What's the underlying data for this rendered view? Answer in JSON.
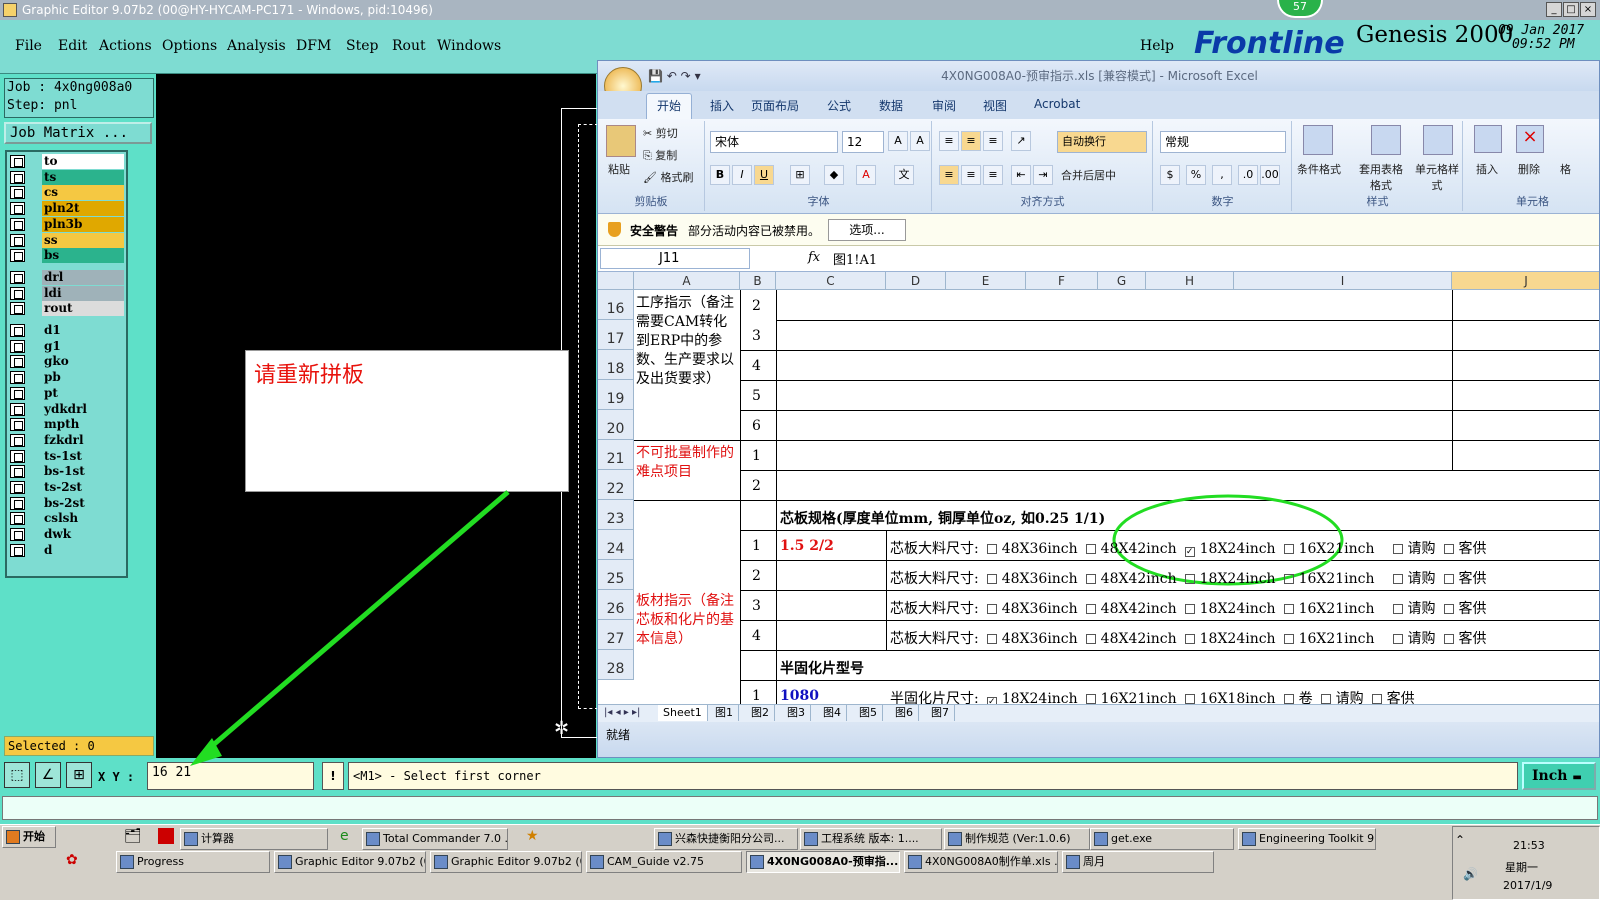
{
  "genesis": {
    "window_title": "Graphic Editor 9.07b2 (00@HY-HYCAM-PC171 - Windows, pid:10496)",
    "menu": [
      "File",
      "Edit",
      "Actions",
      "Options",
      "Analysis",
      "DFM",
      "Step",
      "Rout",
      "Windows"
    ],
    "help": "Help",
    "badge": "57",
    "brand": {
      "logo": "Frontline",
      "product": "Genesis 2000",
      "date": "09 Jan 2017",
      "time": "09:52 PM"
    },
    "job": "Job : 4x0ng008a0",
    "step": "Step: pnl",
    "job_matrix": "Job Matrix ...",
    "layers": [
      {
        "name": "to",
        "color": "#ffffff"
      },
      {
        "name": "ts",
        "color": "#2bb38d"
      },
      {
        "name": "cs",
        "color": "#f5c842"
      },
      {
        "name": "pln2t",
        "color": "#e0a800"
      },
      {
        "name": "pln3b",
        "color": "#e0a800"
      },
      {
        "name": "ss",
        "color": "#f5c842"
      },
      {
        "name": "bs",
        "color": "#2bb38d"
      },
      {
        "name": "drl",
        "color": "#9fb2b9"
      },
      {
        "name": "ldi",
        "color": "#9fb2b9"
      },
      {
        "name": "rout",
        "color": "#dcdcdc"
      },
      {
        "name": "d1",
        "color": "#7edcd2"
      },
      {
        "name": "g1",
        "color": "#7edcd2"
      },
      {
        "name": "gko",
        "color": "#7edcd2"
      },
      {
        "name": "pb",
        "color": "#7edcd2"
      },
      {
        "name": "pt",
        "color": "#7edcd2"
      },
      {
        "name": "ydkdrl",
        "color": "#7edcd2"
      },
      {
        "name": "mpth",
        "color": "#7edcd2"
      },
      {
        "name": "fzkdrl",
        "color": "#7edcd2"
      },
      {
        "name": "ts-1st",
        "color": "#7edcd2"
      },
      {
        "name": "bs-1st",
        "color": "#7edcd2"
      },
      {
        "name": "ts-2st",
        "color": "#7edcd2"
      },
      {
        "name": "bs-2st",
        "color": "#7edcd2"
      },
      {
        "name": "cslsh",
        "color": "#7edcd2"
      },
      {
        "name": "dwk",
        "color": "#7edcd2"
      },
      {
        "name": "d",
        "color": "#7edcd2"
      }
    ],
    "selected": "Selected : 0",
    "note_text": "请重新拼板",
    "xy_label": "X Y :",
    "xy_value": "16 21",
    "prompt": "<M1> - Select first corner",
    "unit": "Inch"
  },
  "excel": {
    "title": "4X0NG008A0-预审指示.xls  [兼容模式] - Microsoft Excel",
    "tabs": [
      "开始",
      "插入",
      "页面布局",
      "公式",
      "数据",
      "审阅",
      "视图",
      "Acrobat"
    ],
    "clipboard": {
      "paste": "粘贴",
      "cut": "剪切",
      "copy": "复制",
      "format_painter": "格式刷",
      "label": "剪贴板"
    },
    "font": {
      "name": "宋体",
      "size": "12",
      "label": "字体"
    },
    "alignment": {
      "wrap": "自动换行",
      "merge": "合并后居中",
      "label": "对齐方式"
    },
    "number": {
      "format": "常规",
      "label": "数字"
    },
    "styles": {
      "cond": "条件格式",
      "table": "套用表格格式",
      "cell": "单元格样式",
      "label": "样式"
    },
    "cells": {
      "insert": "插入",
      "delete": "删除",
      "format": "格",
      "label": "单元格"
    },
    "security": {
      "title": "安全警告",
      "message": "部分活动内容已被禁用。",
      "options": "选项..."
    },
    "name_box": "J11",
    "formula": "图1!A1",
    "columns": [
      "A",
      "B",
      "C",
      "D",
      "E",
      "F",
      "G",
      "H",
      "I",
      "J"
    ],
    "rows": [
      "16",
      "17",
      "18",
      "19",
      "20",
      "21",
      "22",
      "23",
      "24",
      "25",
      "26",
      "27",
      "28"
    ],
    "section1": "工序指示（备注需要CAM转化到ERP中的参数、生产要求以及出货要求）",
    "section1_nums": [
      "2",
      "3",
      "4",
      "5",
      "6"
    ],
    "section2": "不可批量制作的难点项目",
    "section2_nums": [
      "1",
      "2"
    ],
    "section3": "板材指示（备注芯板和化片的基本信息）",
    "core_header": "芯板规格(厚度单位mm, 铜厚单位oz, 如0.25 1/1)",
    "core_rows": [
      {
        "num": "1",
        "spec": "1.5 2/2",
        "label": "芯板大料尺寸:",
        "checked": "18X24inch"
      },
      {
        "num": "2",
        "spec": "",
        "label": "芯板大料尺寸:",
        "checked": ""
      },
      {
        "num": "3",
        "spec": "",
        "label": "芯板大料尺寸:",
        "checked": ""
      },
      {
        "num": "4",
        "spec": "",
        "label": "芯板大料尺寸:",
        "checked": ""
      }
    ],
    "core_options": [
      "48X36inch",
      "48X42inch",
      "18X24inch",
      "16X21inch",
      "请购",
      "客供"
    ],
    "pp_header": "半固化片型号",
    "pp_row": {
      "num": "1",
      "spec": "1080",
      "label": "半固化片尺寸:",
      "options": [
        "18X24inch",
        "16X21inch",
        "16X18inch",
        "卷",
        "请购",
        "客供"
      ]
    },
    "sheets": [
      "Sheet1",
      "图1",
      "图2",
      "图3",
      "图4",
      "图5",
      "图6",
      "图7"
    ],
    "status": "就绪"
  },
  "taskbar": {
    "start": "开始",
    "row1": [
      "计算器",
      "Total Commander 7.0 ...",
      "兴森快捷衡阳分公司...",
      "工程系统  版本: 1....",
      "制作规范 (Ver:1.0.6)",
      "get.exe",
      "Engineering Toolkit 9...."
    ],
    "row2": [
      "Progress",
      "Graphic Editor 9.07b2 (0...",
      "Graphic Editor 9.07b2 (0...",
      "CAM_Guide v2.75",
      "4X0NG008A0-预审指...",
      "4X0NG008A0制作单.xls ...",
      "周月"
    ],
    "clock": {
      "time": "21:53",
      "weekday": "星期一",
      "date": "2017/1/9"
    }
  },
  "annotation_color": "#22dd22"
}
